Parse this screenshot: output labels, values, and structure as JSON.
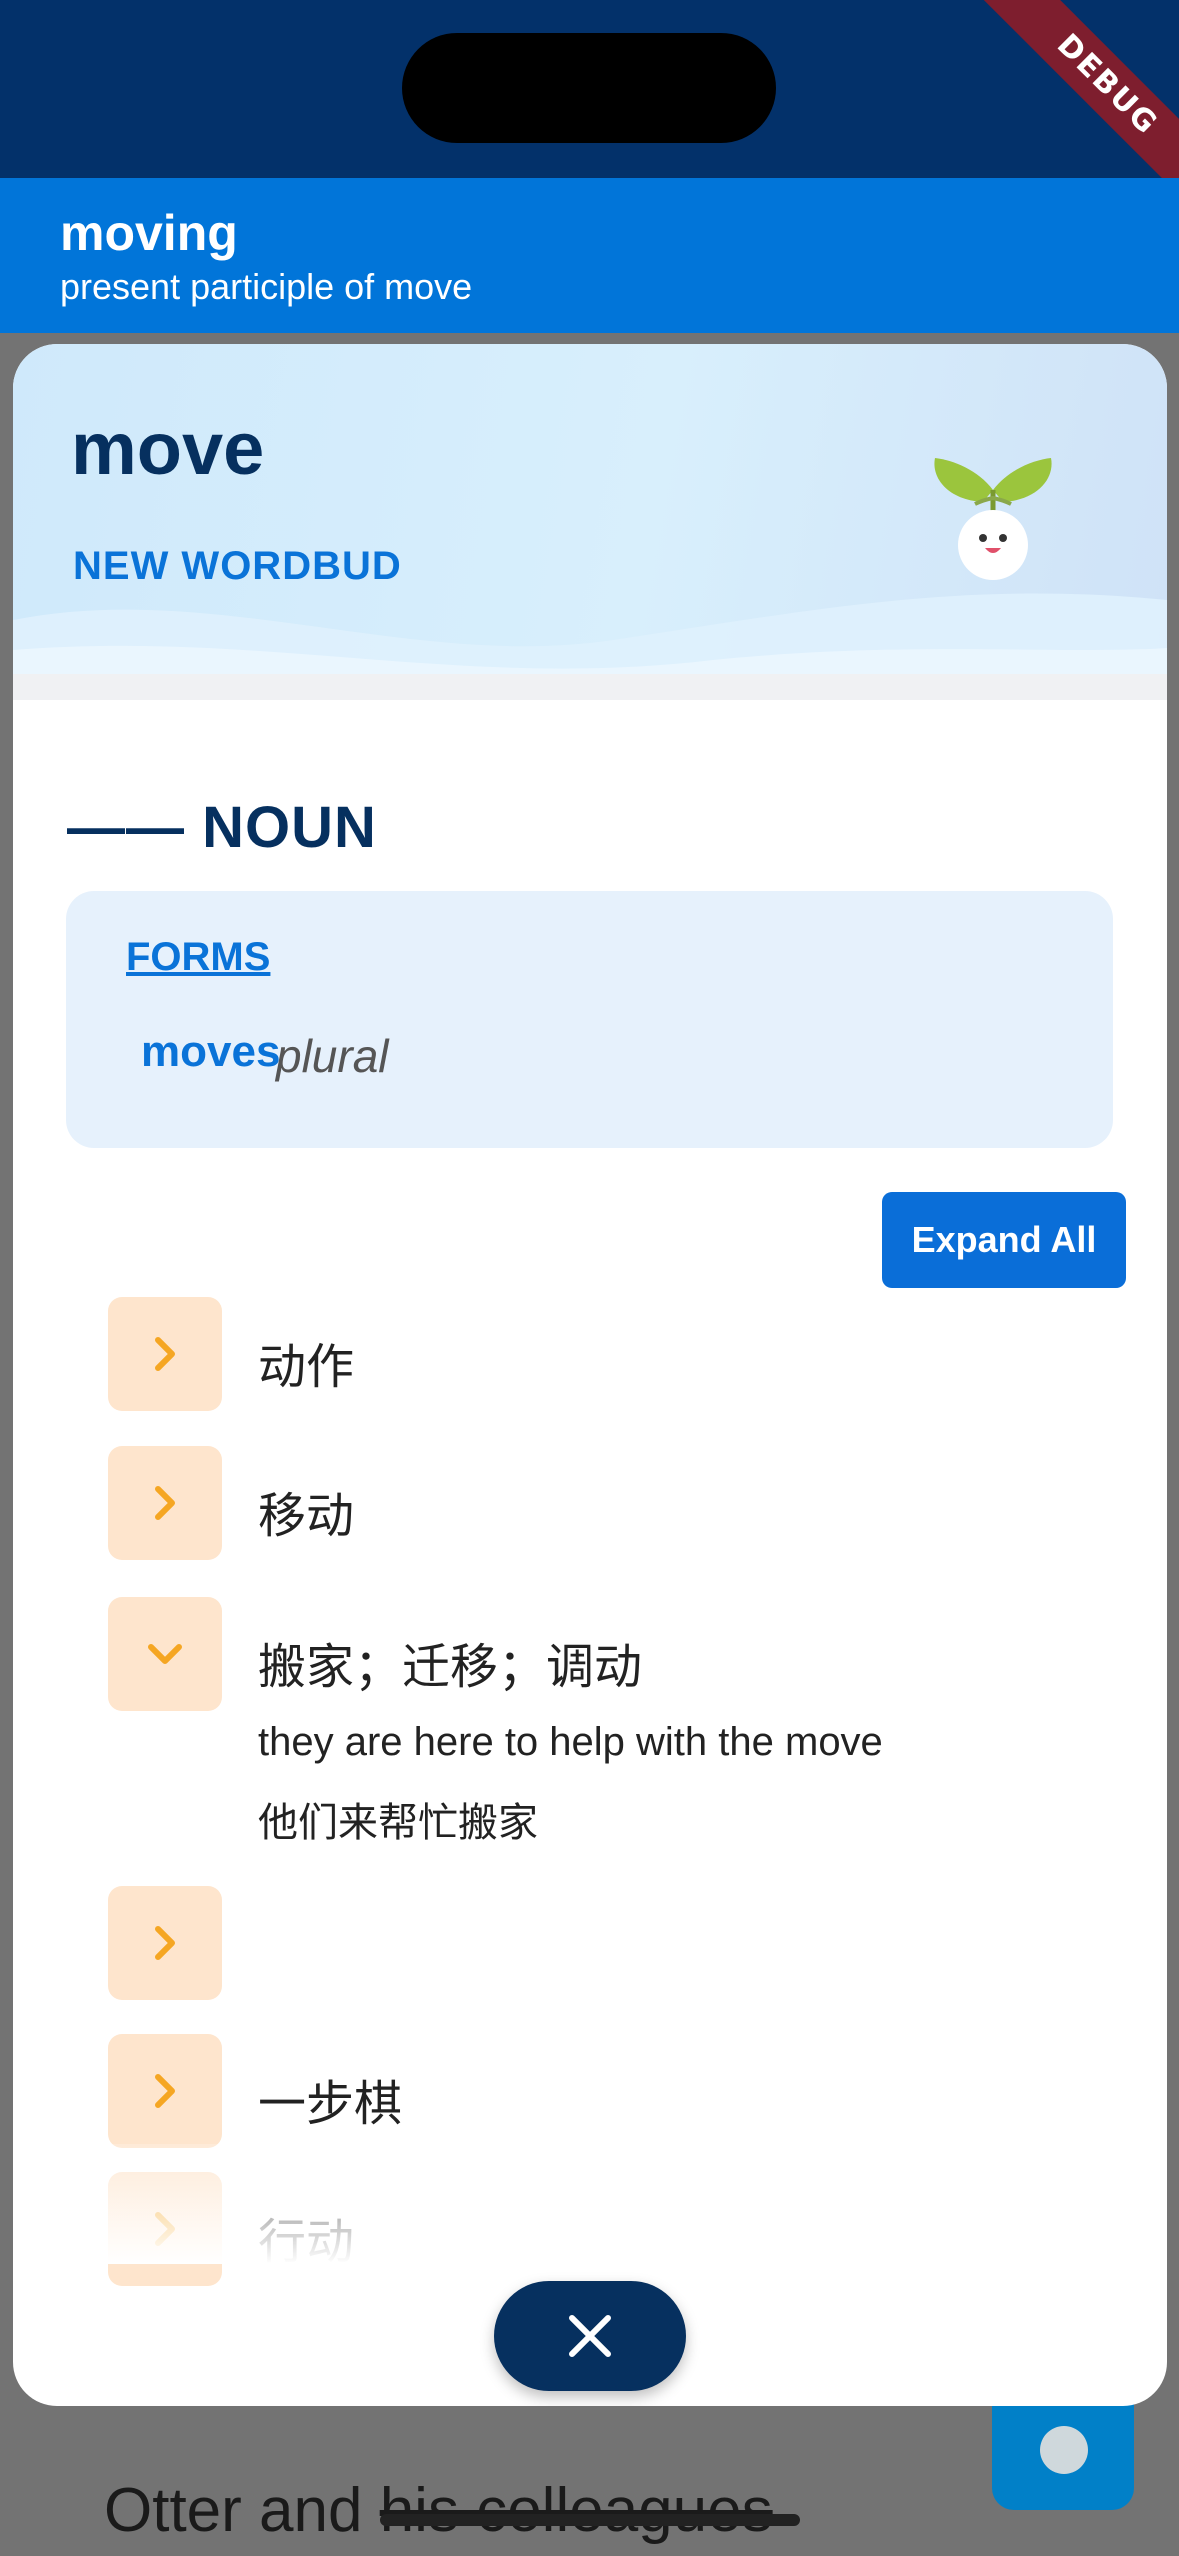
{
  "debug_banner": "DEBUG",
  "appbar": {
    "title": "moving",
    "subtitle": "present participle of move"
  },
  "card": {
    "word": "move",
    "badge": "NEW WORDBUD",
    "part_of_speech": "—— NOUN",
    "forms": {
      "label": "FORMS",
      "items": [
        {
          "word": "moves",
          "type": "plural"
        }
      ]
    },
    "expand_all": "Expand All",
    "senses": [
      {
        "meaning": "动作",
        "expanded": false
      },
      {
        "meaning": "移动",
        "expanded": false
      },
      {
        "meaning": "搬家；迁移；调动",
        "expanded": true,
        "example_en": "they are here to help with the move",
        "example_zh": "他们来帮忙搬家"
      },
      {
        "meaning": "",
        "expanded": false
      },
      {
        "meaning": "一步棋",
        "expanded": false
      },
      {
        "meaning": "行动",
        "expanded": false
      }
    ],
    "icons": {
      "close": "close-icon",
      "chevron_right": "chevron-right-icon",
      "chevron_down": "chevron-down-icon",
      "mascot": "sprout-mascot-icon"
    }
  },
  "background": {
    "text_plain": "Otter and ",
    "text_struck": "his colleagues"
  },
  "colors": {
    "primary": "#0175D9",
    "dark_navy": "#06305F",
    "accent_orange": "#F5A623",
    "chevron_bg": "#FEE5CD",
    "forms_bg": "#E6F1FC"
  }
}
